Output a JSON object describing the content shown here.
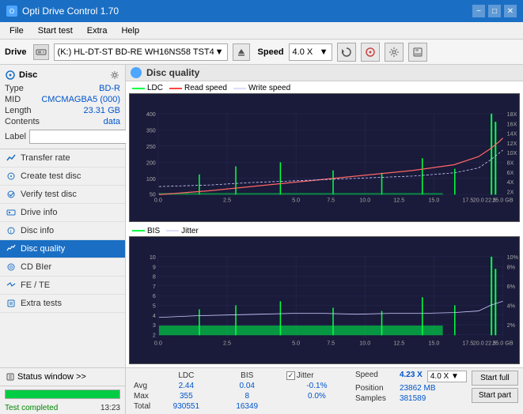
{
  "app": {
    "title": "Opti Drive Control 1.70",
    "icon": "disc-icon"
  },
  "title_controls": {
    "minimize": "−",
    "maximize": "□",
    "close": "✕"
  },
  "menu": {
    "items": [
      "File",
      "Start test",
      "Extra",
      "Help"
    ]
  },
  "drive_toolbar": {
    "drive_label": "Drive",
    "drive_value": "(K:)  HL-DT-ST BD-RE  WH16NS58 TST4",
    "speed_label": "Speed",
    "speed_value": "4.0 X",
    "eject_icon": "eject-icon"
  },
  "disc_panel": {
    "header": "Disc",
    "type_label": "Type",
    "type_value": "BD-R",
    "mid_label": "MID",
    "mid_value": "CMCMAGBA5 (000)",
    "length_label": "Length",
    "length_value": "23.31 GB",
    "contents_label": "Contents",
    "contents_value": "data",
    "label_label": "Label"
  },
  "nav_items": [
    {
      "id": "transfer-rate",
      "label": "Transfer rate",
      "icon": "chart-icon"
    },
    {
      "id": "create-test-disc",
      "label": "Create test disc",
      "icon": "disc-icon"
    },
    {
      "id": "verify-test-disc",
      "label": "Verify test disc",
      "icon": "verify-icon"
    },
    {
      "id": "drive-info",
      "label": "Drive info",
      "icon": "info-icon"
    },
    {
      "id": "disc-info",
      "label": "Disc info",
      "icon": "disc-info-icon"
    },
    {
      "id": "disc-quality",
      "label": "Disc quality",
      "icon": "quality-icon",
      "active": true
    },
    {
      "id": "cd-bier",
      "label": "CD BIer",
      "icon": "cd-icon"
    },
    {
      "id": "fe-te",
      "label": "FE / TE",
      "icon": "fe-icon"
    },
    {
      "id": "extra-tests",
      "label": "Extra tests",
      "icon": "extra-icon"
    }
  ],
  "status_window": {
    "label": "Status window >>",
    "progress": 100,
    "completed_text": "Test completed",
    "time": "13:23"
  },
  "content": {
    "title": "Disc quality",
    "chart1": {
      "legend": [
        {
          "color": "green",
          "label": "LDC"
        },
        {
          "color": "red",
          "label": "Read speed"
        },
        {
          "color": "white",
          "label": "Write speed"
        }
      ],
      "y_max": 400,
      "y_right_max": 18,
      "y_right_label": "X",
      "x_max": 25,
      "x_label": "GB"
    },
    "chart2": {
      "legend": [
        {
          "color": "green",
          "label": "BIS"
        },
        {
          "color": "white",
          "label": "Jitter"
        }
      ],
      "y_max": 10,
      "y_right_max": 10,
      "y_right_label": "%",
      "x_max": 25,
      "x_label": "GB"
    }
  },
  "stats": {
    "columns": [
      "LDC",
      "BIS",
      "",
      "Jitter",
      "Speed",
      ""
    ],
    "rows": [
      {
        "label": "Avg",
        "ldc": "2.44",
        "bis": "0.04",
        "jitter": "-0.1%",
        "speed_label": "Position",
        "speed_value": "23862 MB"
      },
      {
        "label": "Max",
        "ldc": "355",
        "bis": "8",
        "jitter": "0.0%",
        "speed_label": "Samples",
        "speed_value": "381589"
      },
      {
        "label": "Total",
        "ldc": "930551",
        "bis": "16349",
        "jitter": ""
      }
    ],
    "speed_current": "4.23 X",
    "speed_selected": "4.0 X",
    "jitter_checked": true,
    "jitter_label": "Jitter",
    "start_full_label": "Start full",
    "start_part_label": "Start part"
  }
}
